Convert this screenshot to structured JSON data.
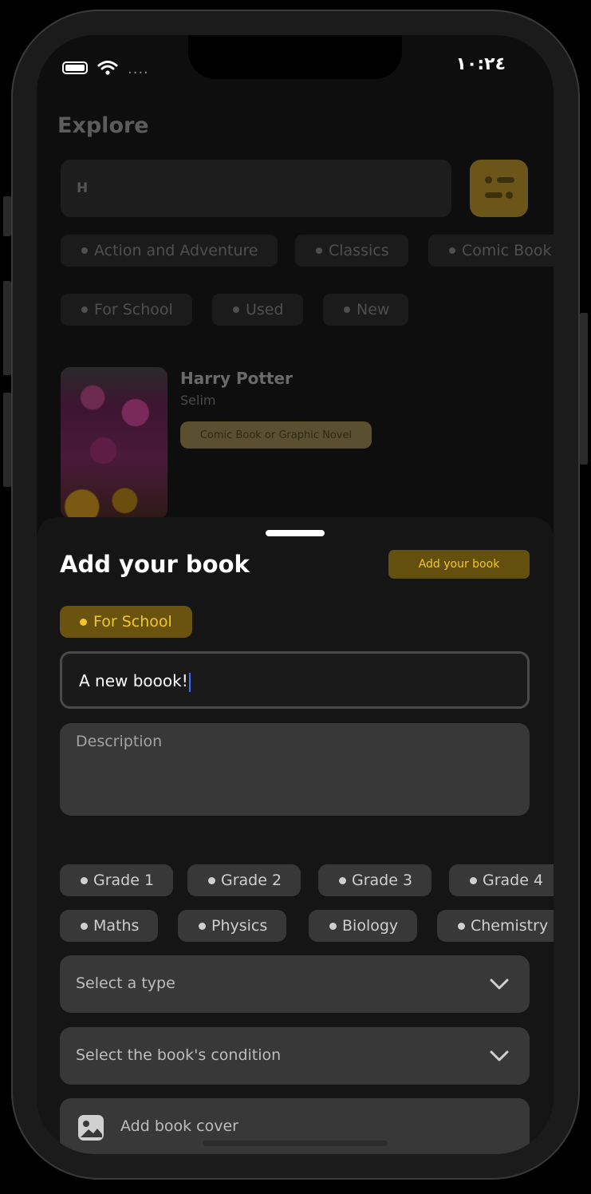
{
  "status_bar": {
    "time": "١٠:٢٤",
    "signal_dots": "...."
  },
  "background": {
    "title": "Explore",
    "search_value": "H",
    "categories_row1": [
      "Action and Adventure",
      "Classics",
      "Comic Book or Graphic Novel"
    ],
    "categories_row2": [
      "For School",
      "Used",
      "New"
    ],
    "book": {
      "title": "Harry Potter",
      "author": "Selim",
      "tag": "Comic Book or Graphic Novel"
    }
  },
  "sheet": {
    "title": "Add your book",
    "add_button_label": "Add your book",
    "selected_category": "For School",
    "title_input_value": "A new boook!",
    "description_placeholder": "Description",
    "grades": [
      "Grade 1",
      "Grade 2",
      "Grade 3",
      "Grade 4"
    ],
    "subjects": [
      "Maths",
      "Physics",
      "Biology",
      "Chemistry"
    ],
    "type_select_placeholder": "Select a type",
    "condition_select_placeholder": "Select the book's condition",
    "cover_button_label": "Add book cover"
  },
  "colors": {
    "accent": "#f0c62e",
    "accent_bg": "#63500f",
    "surface": "#383838"
  }
}
